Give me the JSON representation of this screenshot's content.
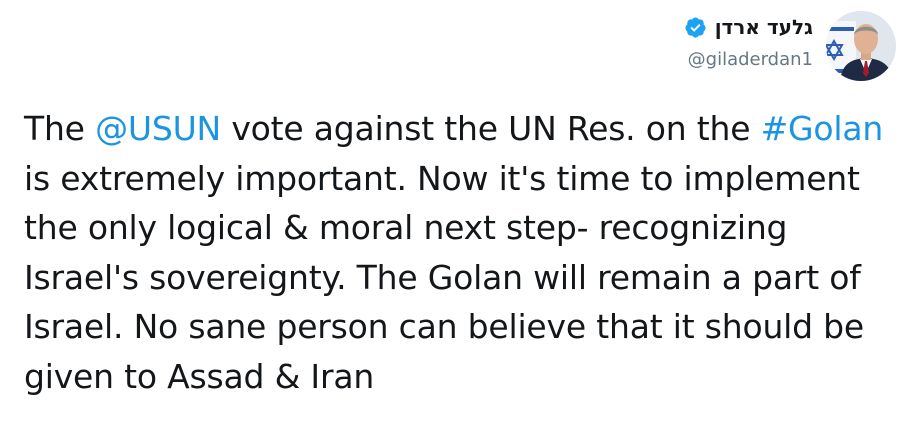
{
  "author": {
    "display_name": "גלעד ארדן",
    "handle": "@giladerdan1",
    "verified": true,
    "verified_color": "#1da1f2",
    "avatar_icon": "profile-photo"
  },
  "tweet": {
    "segments": [
      {
        "text": "The ",
        "type": "text"
      },
      {
        "text": "@USUN",
        "type": "mention"
      },
      {
        "text": " vote against the UN Res. on the ",
        "type": "text"
      },
      {
        "text": "#Golan",
        "type": "hashtag"
      },
      {
        "text": " is extremely important. Now it's time to implement the only logical & moral next step- recognizing Israel's sovereignty. The Golan will remain a part of Israel. No sane person can believe that it should be given to Assad & Iran",
        "type": "text"
      }
    ],
    "link_color": "#1b95e0",
    "text_color": "#14171a"
  }
}
